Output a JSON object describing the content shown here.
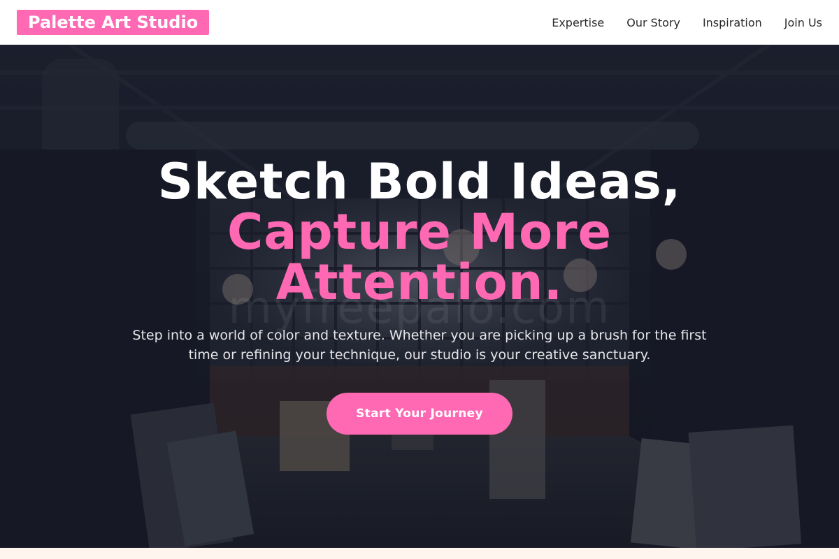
{
  "header": {
    "brand": "Palette Art Studio",
    "nav": [
      {
        "label": "Expertise"
      },
      {
        "label": "Our Story"
      },
      {
        "label": "Inspiration"
      },
      {
        "label": "Join Us"
      }
    ]
  },
  "hero": {
    "headline_line1": "Sketch Bold Ideas,",
    "headline_line2": "Capture More",
    "headline_line3": "Attention.",
    "subtext": "Step into a world of color and texture. Whether you are picking up a brush for the first time or refining your technique, our studio is your creative sanctuary.",
    "cta_label": "Start Your Journey",
    "watermark": "myfreepalo.com"
  },
  "colors": {
    "accent": "#ff69b4",
    "header_bg": "#ffffff",
    "hero_overlay": "#0f121e",
    "page_bg": "#fff7f2"
  }
}
